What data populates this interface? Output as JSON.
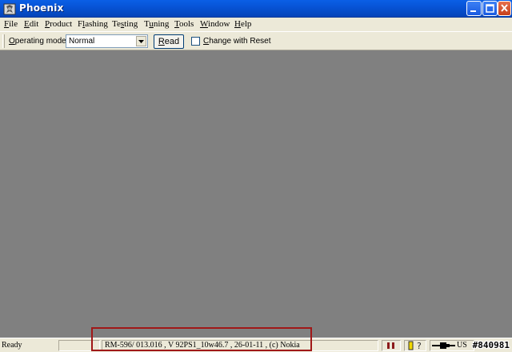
{
  "window": {
    "title": "Phoenix"
  },
  "menu": {
    "items": [
      {
        "label": "File",
        "key": "F"
      },
      {
        "label": "Edit",
        "key": "E"
      },
      {
        "label": "Product",
        "key": "P"
      },
      {
        "label": "Flashing",
        "key": "l"
      },
      {
        "label": "Testing",
        "key": "s"
      },
      {
        "label": "Tuning",
        "key": "u"
      },
      {
        "label": "Tools",
        "key": "T"
      },
      {
        "label": "Window",
        "key": "W"
      },
      {
        "label": "Help",
        "key": "H"
      }
    ]
  },
  "toolbar": {
    "operating_mode_label": "Operating mode:",
    "operating_mode_value": "Normal",
    "read_label": "Read",
    "change_reset_label": "Change with Reset",
    "change_reset_checked": false
  },
  "status": {
    "ready": "Ready",
    "device_info": "RM-596/ 013.016 , V 92PS1_10w46.7 , 26-01-11 , (c) Nokia",
    "connection": "US",
    "watermark": "#840981"
  },
  "colors": {
    "titlebar": "#0754d6",
    "workspace": "#808080",
    "highlight": "#a01818",
    "chrome": "#ece9d8"
  }
}
